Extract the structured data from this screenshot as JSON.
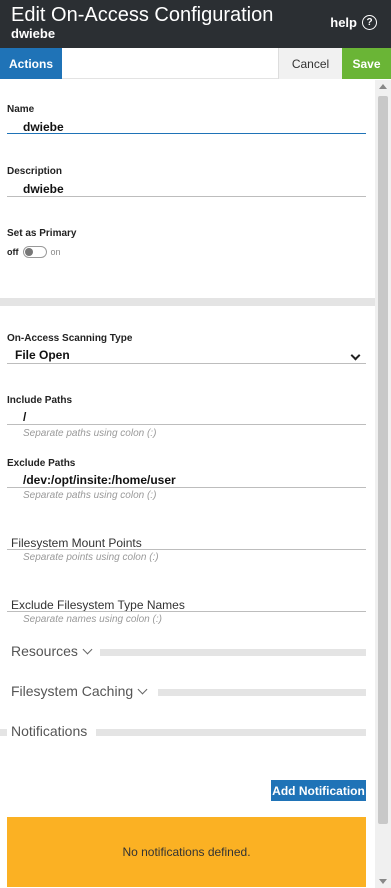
{
  "header": {
    "title": "Edit On-Access Configuration",
    "subtitle": "dwiebe",
    "help_label": "help",
    "help_icon_glyph": "?"
  },
  "toolbar": {
    "actions_label": "Actions",
    "cancel_label": "Cancel",
    "save_label": "Save"
  },
  "form": {
    "name": {
      "label": "Name",
      "value": "dwiebe"
    },
    "description": {
      "label": "Description",
      "value": "dwiebe"
    },
    "primary": {
      "label": "Set as Primary",
      "off_label": "off",
      "on_label": "on",
      "state": "off"
    },
    "scan_type": {
      "label": "On-Access Scanning Type",
      "value": "File Open"
    },
    "include_paths": {
      "label": "Include Paths",
      "value": "/",
      "hint": "Separate paths using colon (:)"
    },
    "exclude_paths": {
      "label": "Exclude Paths",
      "value": "/dev:/opt/insite:/home/user",
      "hint": "Separate paths using colon (:)"
    },
    "mount_points": {
      "placeholder": "Filesystem Mount Points",
      "hint": "Separate points using colon (:)"
    },
    "exclude_fs_types": {
      "placeholder": "Exclude Filesystem Type Names",
      "hint": "Separate names using colon (:)"
    }
  },
  "sections": {
    "resources": "Resources",
    "caching": "Filesystem Caching",
    "notifications": "Notifications"
  },
  "notifications": {
    "add_label": "Add Notification",
    "empty_message": "No notifications defined."
  },
  "colors": {
    "header_bg": "#2b2f33",
    "accent_blue": "#1f73b7",
    "save_green": "#6ab536",
    "warning_yellow": "#fbb123"
  }
}
